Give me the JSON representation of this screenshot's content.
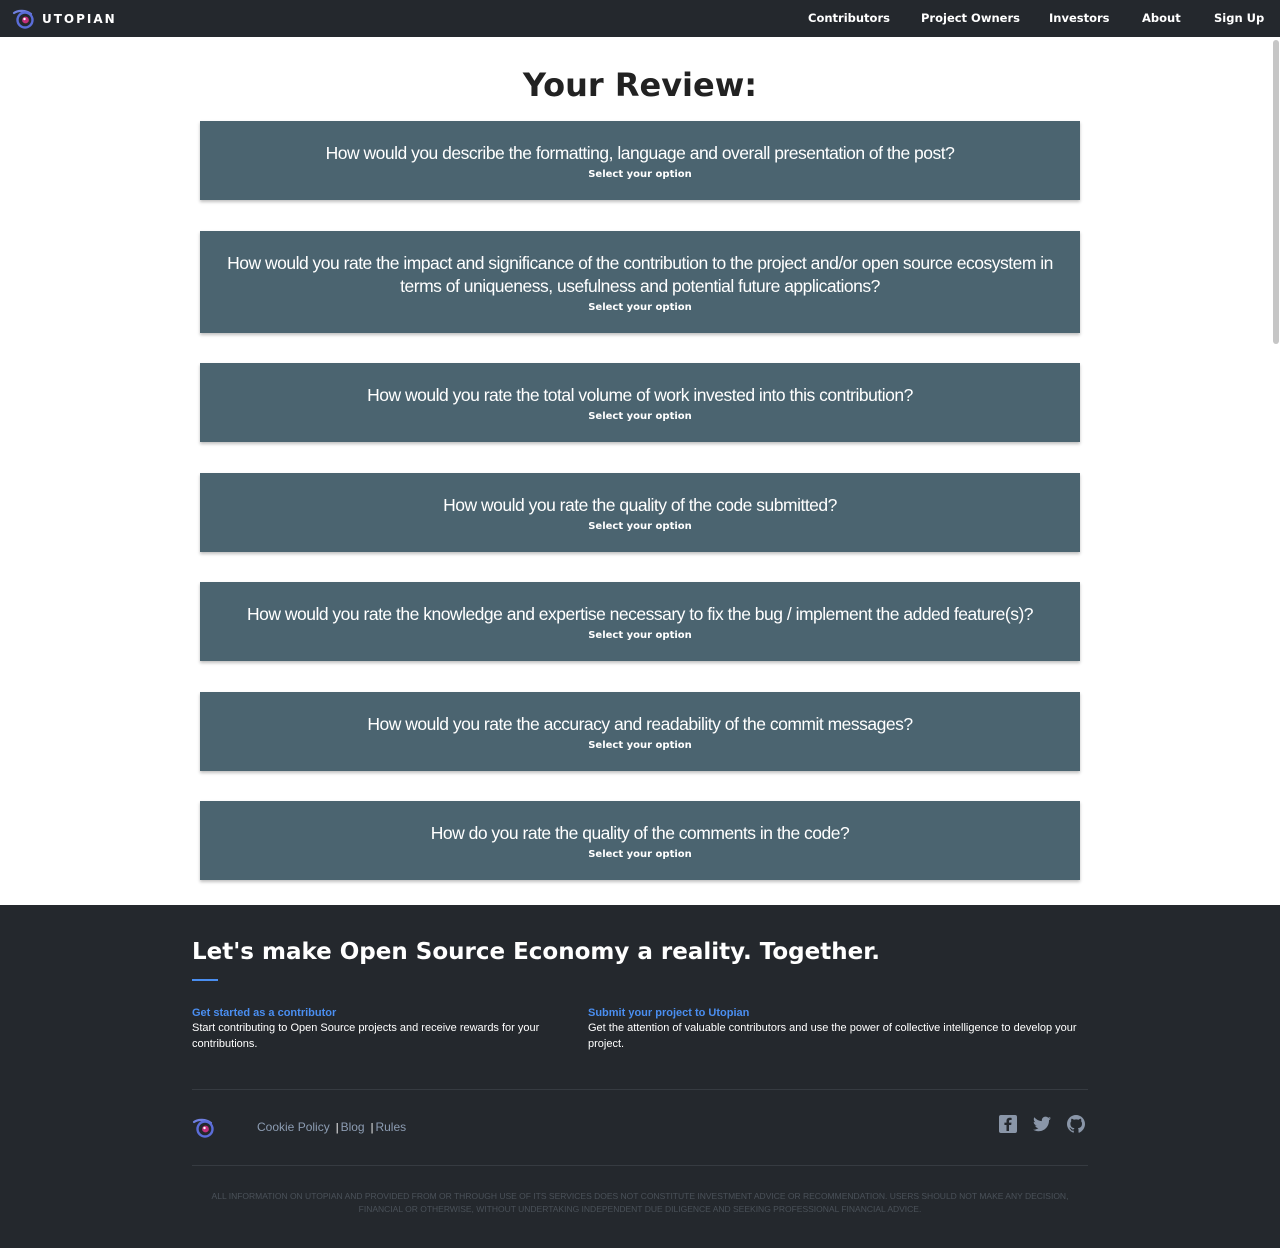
{
  "header": {
    "brand_name": "UTOPIAN",
    "nav": [
      "Contributors",
      "Project Owners",
      "Investors",
      "About",
      "Sign Up"
    ]
  },
  "main": {
    "title": "Your Review:",
    "select_label": "Select your option",
    "questions": [
      "How would you describe the formatting, language and overall presentation of the post?",
      "How would you rate the impact and significance of the contribution to the project and/or open source ecosystem in terms of uniqueness, usefulness and potential future applications?",
      "How would you rate the total volume of work invested into this contribution?",
      "How would you rate the quality of the code submitted?",
      "How would you rate the knowledge and expertise necessary to fix the bug / implement the added feature(s)?",
      "How would you rate the accuracy and readability of the commit messages?",
      "How do you rate the quality of the comments in the code?"
    ]
  },
  "footer": {
    "title": "Let's make Open Source Economy a reality. Together.",
    "contributor_heading": "Get started as a contributor",
    "contributor_desc": "Start contributing to Open Source projects and receive rewards for your contributions.",
    "project_heading": "Submit your project to Utopian",
    "project_desc": "Get the attention of valuable contributors and use the power of collective intelligence to develop your project.",
    "links": [
      "Cookie Policy",
      "Blog",
      "Rules"
    ],
    "link_separator": "|",
    "social_icons": [
      "facebook-icon",
      "twitter-icon",
      "github-icon"
    ],
    "disclaimer": "All information on Utopian and provided from or through use of its services does not constitute investment advice or recommendation. Users should not make any decision, financial or otherwise, without undertaking independent due diligence and seeking professional financial advice."
  },
  "colors": {
    "nav_background": "#24282d",
    "card_background": "#4b6470",
    "accent_link": "#4a8ef0",
    "footer_link": "#8c9cb2"
  }
}
